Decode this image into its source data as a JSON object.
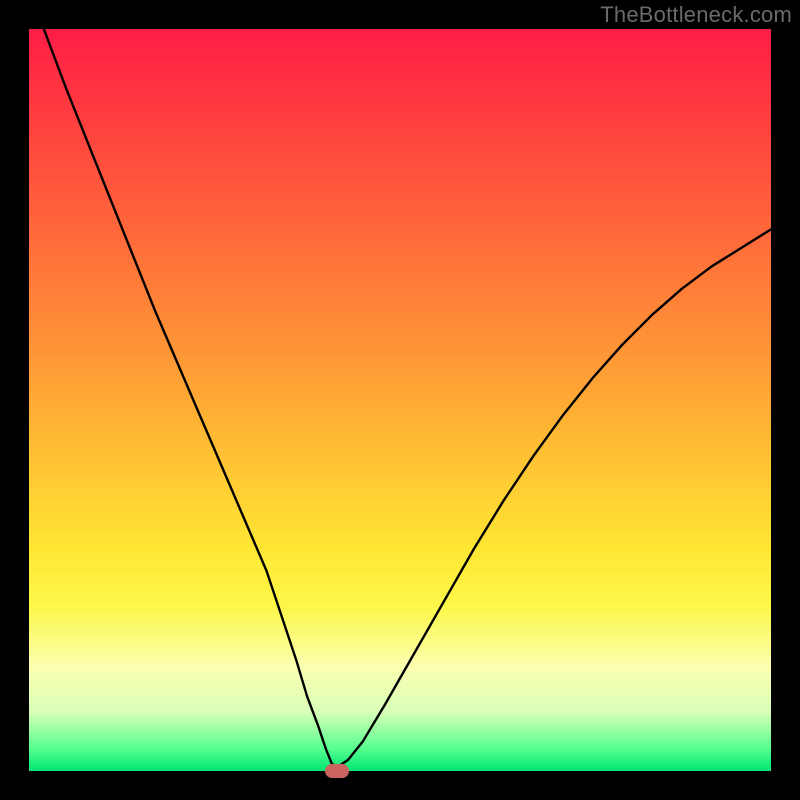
{
  "watermark": "TheBottleneck.com",
  "chart_data": {
    "type": "line",
    "title": "",
    "xlabel": "",
    "ylabel": "",
    "xlim": [
      0,
      100
    ],
    "ylim": [
      0,
      100
    ],
    "grid": false,
    "gradient_stops": [
      {
        "pct": 0,
        "color": "#ff1d46"
      },
      {
        "pct": 12,
        "color": "#ff3e3f"
      },
      {
        "pct": 28,
        "color": "#ff6a3a"
      },
      {
        "pct": 44,
        "color": "#ff9736"
      },
      {
        "pct": 58,
        "color": "#ffc233"
      },
      {
        "pct": 70,
        "color": "#ffe633"
      },
      {
        "pct": 78,
        "color": "#fdf84b"
      },
      {
        "pct": 86,
        "color": "#fbffb0"
      },
      {
        "pct": 92,
        "color": "#d9ffb8"
      },
      {
        "pct": 97,
        "color": "#56ff8f"
      },
      {
        "pct": 100,
        "color": "#00e572"
      }
    ],
    "series": [
      {
        "name": "bottleneck-curve",
        "x": [
          2,
          5,
          8,
          11,
          14,
          17,
          20,
          23,
          26,
          29,
          32,
          34,
          36,
          37.5,
          39,
          40,
          40.8,
          41.5,
          43,
          45,
          48,
          52,
          56,
          60,
          64,
          68,
          72,
          76,
          80,
          84,
          88,
          92,
          96,
          100
        ],
        "y": [
          100,
          92,
          84.5,
          77,
          69.5,
          62,
          55,
          48,
          41,
          34,
          27,
          21,
          15,
          10,
          6,
          3,
          1,
          0.5,
          1.5,
          4,
          9,
          16,
          23,
          30,
          36.5,
          42.5,
          48,
          53,
          57.5,
          61.5,
          65,
          68,
          70.5,
          73
        ],
        "color": "#000000",
        "min_point": {
          "x": 41.5,
          "y": 0.5
        }
      }
    ],
    "marker": {
      "x": 41.5,
      "y": 0,
      "color": "#c9645f"
    }
  }
}
